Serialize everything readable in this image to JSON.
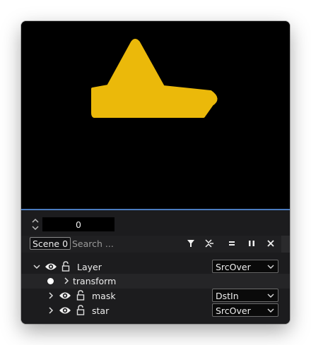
{
  "canvas": {
    "background": "#000000",
    "shape_color": "#ebb90a",
    "shape_icon": "hat-shape"
  },
  "timeline": {
    "frame_value": "0"
  },
  "toolbar": {
    "scene_label": "Scene 0",
    "search_placeholder": "Search ...",
    "icons": [
      "filter-icon",
      "collapse-icon",
      "equals-icon",
      "pause-icon",
      "close-icon"
    ]
  },
  "layers": {
    "rows": [
      {
        "label": "Layer",
        "blend": "SrcOver"
      },
      {
        "label": "transform"
      },
      {
        "label": "mask",
        "blend": "DstIn"
      },
      {
        "label": "star",
        "blend": "SrcOver"
      }
    ]
  },
  "colors": {
    "accent": "#4a7bbf",
    "panel_bg": "#1c1c1e"
  }
}
